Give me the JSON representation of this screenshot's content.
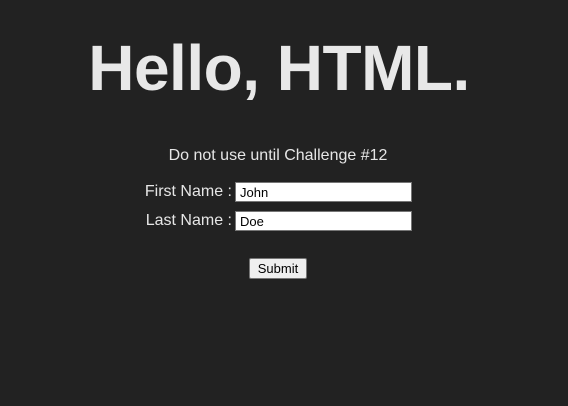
{
  "header": {
    "title": "Hello, HTML."
  },
  "notice": {
    "text": "Do not use until Challenge #12"
  },
  "form": {
    "first_name": {
      "label": "First Name :",
      "value": "John"
    },
    "last_name": {
      "label": "Last Name :",
      "value": "Doe"
    },
    "submit_label": "Submit"
  },
  "colors": {
    "background": "#222222",
    "text": "#e6e6e6"
  }
}
